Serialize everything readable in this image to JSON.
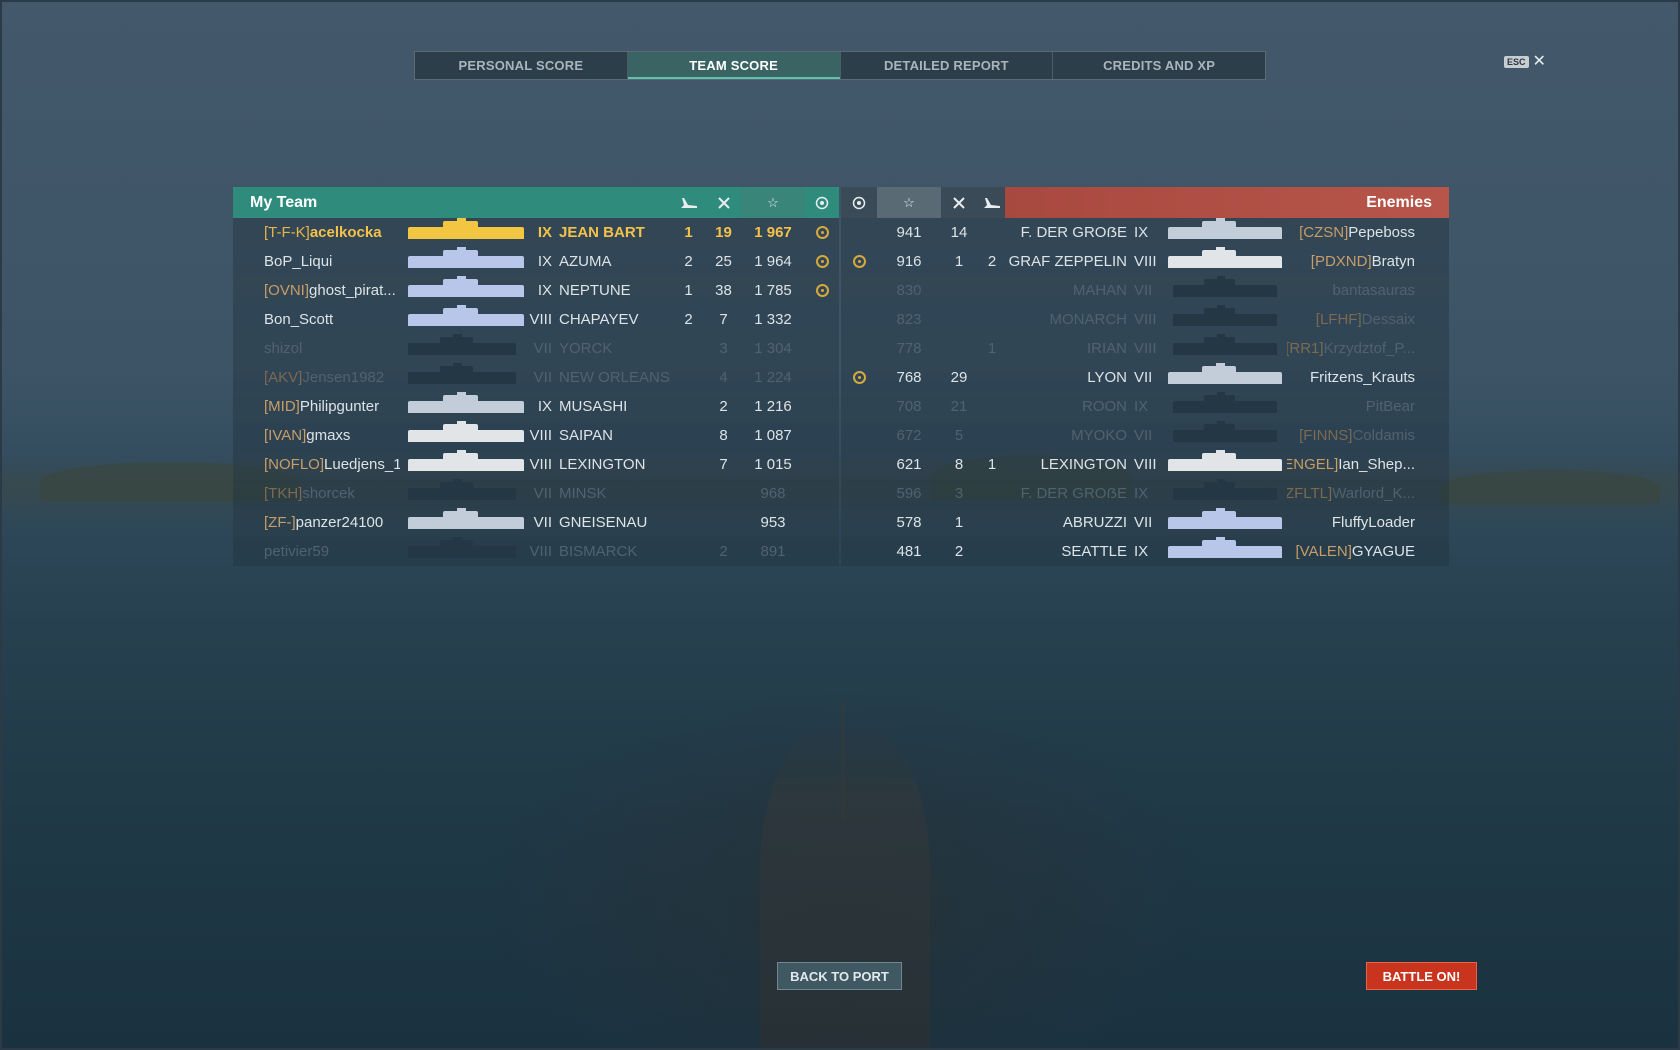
{
  "tabs": [
    {
      "label": "PERSONAL SCORE",
      "active": false
    },
    {
      "label": "TEAM SCORE",
      "active": true
    },
    {
      "label": "DETAILED REPORT",
      "active": false
    },
    {
      "label": "CREDITS AND XP",
      "active": false
    }
  ],
  "close": {
    "key": "ESC",
    "glyph": "✕"
  },
  "my_team": {
    "title": "My Team",
    "columns": [
      "planes-destroyed-icon",
      "ships-destroyed-icon",
      "base-xp-star-icon",
      "achievement-icon"
    ],
    "rows": [
      {
        "clan": "[T-F-K]",
        "player": "acelkocka",
        "tier": "IX",
        "ship": "JEAN BART",
        "planes": "1",
        "kills": "19",
        "score": "1 967",
        "medal": true,
        "state": "me",
        "silhouette": "gold"
      },
      {
        "clan": "",
        "player": "BoP_Liqui",
        "tier": "IX",
        "ship": "AZUMA",
        "planes": "2",
        "kills": "25",
        "score": "1 964",
        "medal": true,
        "state": "alive",
        "silhouette": "blue"
      },
      {
        "clan": "[OVNI]",
        "player": "ghost_pirat...",
        "tier": "IX",
        "ship": "NEPTUNE",
        "planes": "1",
        "kills": "38",
        "score": "1 785",
        "medal": true,
        "state": "alive",
        "silhouette": "blue"
      },
      {
        "clan": "",
        "player": "Bon_Scott",
        "tier": "VIII",
        "ship": "CHAPAYEV",
        "planes": "2",
        "kills": "7",
        "score": "1 332",
        "medal": false,
        "state": "alive",
        "silhouette": "blue"
      },
      {
        "clan": "",
        "player": "shizol",
        "tier": "VII",
        "ship": "YORCK",
        "planes": "",
        "kills": "3",
        "score": "1 304",
        "medal": false,
        "state": "dead",
        "silhouette": "dead"
      },
      {
        "clan": "[AKV]",
        "player": "Jensen1982",
        "tier": "VII",
        "ship": "NEW ORLEANS",
        "planes": "",
        "kills": "4",
        "score": "1 224",
        "medal": false,
        "state": "dead",
        "silhouette": "dead"
      },
      {
        "clan": "[MID]",
        "player": "Philipgunter",
        "tier": "IX",
        "ship": "MUSASHI",
        "planes": "",
        "kills": "2",
        "score": "1 216",
        "medal": false,
        "state": "alive",
        "silhouette": "live"
      },
      {
        "clan": "[IVAN]",
        "player": "gmaxs",
        "tier": "VIII",
        "ship": "SAIPAN",
        "planes": "",
        "kills": "8",
        "score": "1 087",
        "medal": false,
        "state": "alive",
        "silhouette": "white"
      },
      {
        "clan": "[NOFLO]",
        "player": "Luedjens_1",
        "tier": "VIII",
        "ship": "LEXINGTON",
        "planes": "",
        "kills": "7",
        "score": "1 015",
        "medal": false,
        "state": "alive",
        "silhouette": "white"
      },
      {
        "clan": "[TKH]",
        "player": "shorcek",
        "tier": "VII",
        "ship": "MINSK",
        "planes": "",
        "kills": "",
        "score": "968",
        "medal": false,
        "state": "dead",
        "silhouette": "dead"
      },
      {
        "clan": "[ZF-]",
        "player": "panzer24100",
        "tier": "VII",
        "ship": "GNEISENAU",
        "planes": "",
        "kills": "",
        "score": "953",
        "medal": false,
        "state": "alive",
        "silhouette": "live"
      },
      {
        "clan": "",
        "player": "petivier59",
        "tier": "VIII",
        "ship": "BISMARCK",
        "planes": "",
        "kills": "2",
        "score": "891",
        "medal": false,
        "state": "dead",
        "silhouette": "dead"
      }
    ]
  },
  "enemies": {
    "title": "Enemies",
    "columns": [
      "achievement-icon",
      "base-xp-star-icon",
      "ships-destroyed-icon",
      "planes-destroyed-icon"
    ],
    "rows": [
      {
        "medal": false,
        "score": "941",
        "kills": "14",
        "planes": "",
        "ship": "F. DER GROẞE",
        "tier": "IX",
        "clan": "[CZSN]",
        "player": "Pepeboss",
        "state": "alive",
        "silhouette": "live"
      },
      {
        "medal": true,
        "score": "916",
        "kills": "1",
        "planes": "2",
        "ship": "GRAF ZEPPELIN",
        "tier": "VIII",
        "clan": "[PDXND]",
        "player": "Bratyn",
        "state": "alive",
        "silhouette": "white"
      },
      {
        "medal": false,
        "score": "830",
        "kills": "",
        "planes": "",
        "ship": "MAHAN",
        "tier": "VII",
        "clan": "",
        "player": "bantasauras",
        "state": "dead",
        "silhouette": "dead"
      },
      {
        "medal": false,
        "score": "823",
        "kills": "",
        "planes": "",
        "ship": "MONARCH",
        "tier": "VIII",
        "clan": "[LFHF]",
        "player": "Dessaix",
        "state": "dead",
        "silhouette": "dead"
      },
      {
        "medal": false,
        "score": "778",
        "kills": "",
        "planes": "1",
        "ship": "IRIAN",
        "tier": "VIII",
        "clan": "[RR1]",
        "player": "Krzydztof_P...",
        "state": "dead",
        "silhouette": "dead"
      },
      {
        "medal": true,
        "score": "768",
        "kills": "29",
        "planes": "",
        "ship": "LYON",
        "tier": "VII",
        "clan": "",
        "player": "Fritzens_Krauts",
        "state": "alive",
        "silhouette": "live"
      },
      {
        "medal": false,
        "score": "708",
        "kills": "21",
        "planes": "",
        "ship": "ROON",
        "tier": "IX",
        "clan": "",
        "player": "PitBear",
        "state": "dead",
        "silhouette": "dead"
      },
      {
        "medal": false,
        "score": "672",
        "kills": "5",
        "planes": "",
        "ship": "MYOKO",
        "tier": "VII",
        "clan": "[FINNS]",
        "player": "Coldamis",
        "state": "dead",
        "silhouette": "dead"
      },
      {
        "medal": false,
        "score": "621",
        "kills": "8",
        "planes": "1",
        "ship": "LEXINGTON",
        "tier": "VIII",
        "clan": "[ENGEL]",
        "player": "Ian_Shep...",
        "state": "alive",
        "silhouette": "white"
      },
      {
        "medal": false,
        "score": "596",
        "kills": "3",
        "planes": "",
        "ship": "F. DER GROẞE",
        "tier": "IX",
        "clan": "[ZFLTL]",
        "player": "Warlord_K...",
        "state": "dead",
        "silhouette": "dead"
      },
      {
        "medal": false,
        "score": "578",
        "kills": "1",
        "planes": "",
        "ship": "ABRUZZI",
        "tier": "VII",
        "clan": "",
        "player": "FluffyLoader",
        "state": "alive",
        "silhouette": "blue"
      },
      {
        "medal": false,
        "score": "481",
        "kills": "2",
        "planes": "",
        "ship": "SEATTLE",
        "tier": "IX",
        "clan": "[VALEN]",
        "player": "GYAGUE",
        "state": "alive",
        "silhouette": "blue"
      }
    ]
  },
  "buttons": {
    "back": "BACK TO PORT",
    "battle": "BATTLE ON!"
  },
  "colors": {
    "team_header": "#2f8c7d",
    "enemy_header": "#b7554a",
    "self_highlight": "#f4c24a",
    "clan_tag": "#c79d68",
    "battle_button": "#c8341e"
  }
}
